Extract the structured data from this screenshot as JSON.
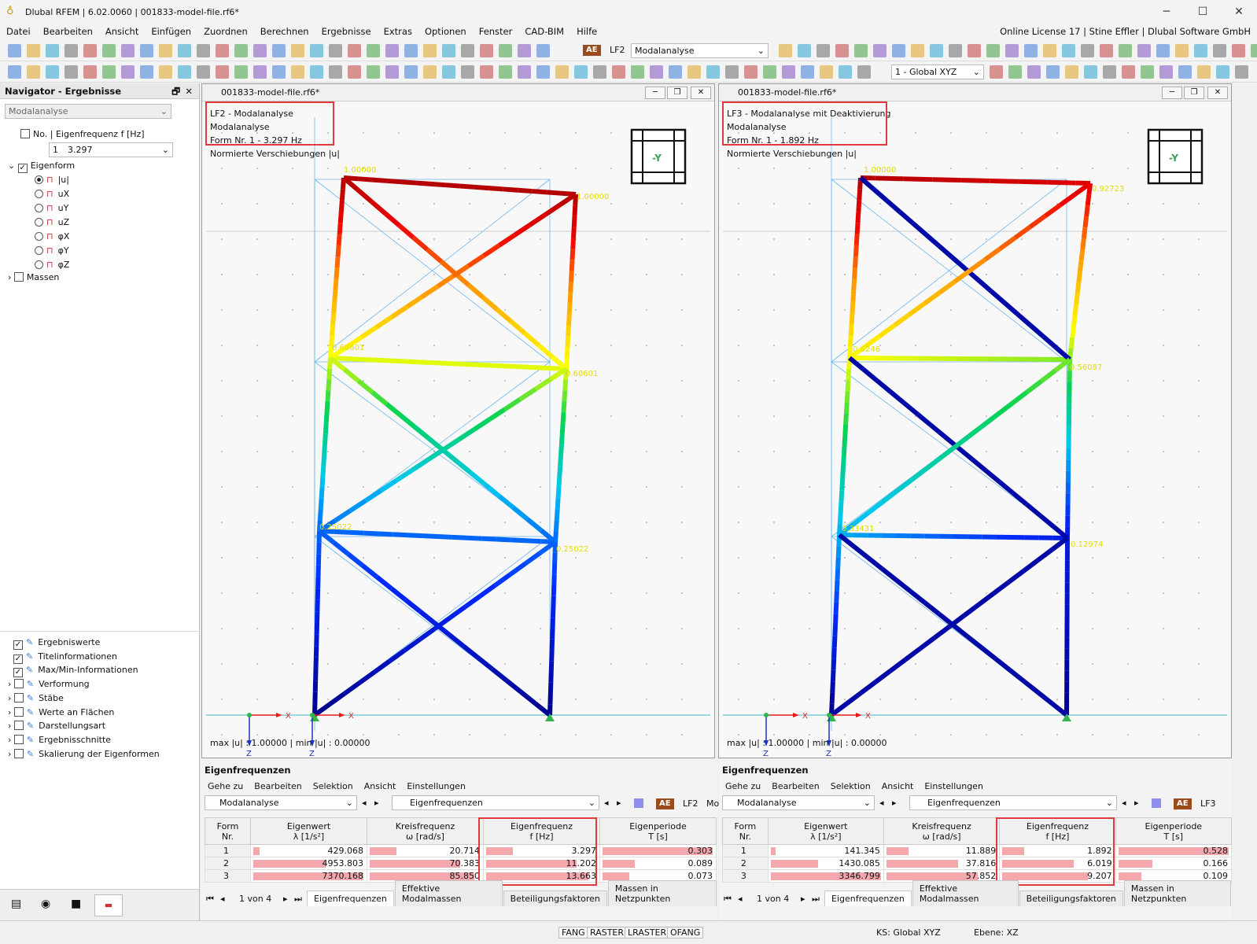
{
  "window": {
    "title": "Dlubal RFEM | 6.02.0060 | 001833-model-file.rf6*",
    "min": "─",
    "max": "☐",
    "close": "✕"
  },
  "menu": {
    "items": [
      "Datei",
      "Bearbeiten",
      "Ansicht",
      "Einfügen",
      "Zuordnen",
      "Berechnen",
      "Ergebnisse",
      "Extras",
      "Optionen",
      "Fenster",
      "CAD-BIM",
      "Hilfe"
    ],
    "license": "Online License 17 | Stine Effler | Dlubal Software GmbH"
  },
  "toolbar": {
    "ae_badge": "AE",
    "loadcase": "LF2",
    "analysis": "Modalanalyse",
    "coord_system": "1 - Global XYZ"
  },
  "navigator": {
    "title": "Navigator - Ergebnisse",
    "analysis": "Modalanalyse",
    "freq_label": "No. | Eigenfrequenz f [Hz]",
    "freq_no": "1",
    "freq_value": "3.297",
    "eigenform": "Eigenform",
    "components": [
      "|u|",
      "uX",
      "uY",
      "uZ",
      "φX",
      "φY",
      "φZ"
    ],
    "massen": "Massen",
    "bottom_items": [
      "Ergebniswerte",
      "Titelinformationen",
      "Max/Min-Informationen",
      "Verformung",
      "Stäbe",
      "Werte an Flächen",
      "Darstellungsart",
      "Ergebnisschnitte",
      "Skalierung der Eigenformen"
    ]
  },
  "views": [
    {
      "file": "001833-model-file.rf6*",
      "line1": "LF2 - Modalanalyse",
      "line2": "Modalanalyse",
      "line3": "Form Nr. 1 - 3.297 Hz",
      "line4": "Normierte Verschiebungen |u|",
      "maxmin": "max |u| : 1.00000 | min |u| : 0.00000",
      "cube": "-Y",
      "labels": [
        "1.00000",
        "1.00000",
        "0.60601",
        "0.60601",
        "0.25022",
        "0.25022"
      ]
    },
    {
      "file": "001833-model-file.rf6*",
      "line1": "LF3 - Modalanalyse mit Deaktivierung",
      "line2": "Modalanalyse",
      "line3": "Form Nr. 1 - 1.892 Hz",
      "line4": "Normierte Verschiebungen |u|",
      "maxmin": "max |u| : 1.00000 | min |u| : 0.00000",
      "cube": "-Y",
      "labels": [
        "1.00000",
        "0.92723",
        "0.6246",
        "0.56087",
        "0.33431",
        "0.12974"
      ]
    }
  ],
  "axes": {
    "x": "X",
    "z": "Z"
  },
  "panels": [
    {
      "title": "Eigenfrequenzen",
      "menu": [
        "Gehe zu",
        "Bearbeiten",
        "Selektion",
        "Ansicht",
        "Einstellungen"
      ],
      "combo1": "Modalanalyse",
      "combo2": "Eigenfrequenzen",
      "ae": "AE",
      "lf": "LF2",
      "mo": "Mo",
      "headers": [
        [
          "Form",
          "Nr."
        ],
        [
          "Eigenwert",
          "λ [1/s²]"
        ],
        [
          "Kreisfrequenz",
          "ω [rad/s]"
        ],
        [
          "Eigenfrequenz",
          "f [Hz]"
        ],
        [
          "Eigenperiode",
          "T [s]"
        ]
      ],
      "rows": [
        [
          "1",
          "429.068",
          "20.714",
          "3.297",
          "0.303"
        ],
        [
          "2",
          "4953.803",
          "70.383",
          "11.202",
          "0.089"
        ],
        [
          "3",
          "7370.168",
          "85.850",
          "13.663",
          "0.073"
        ]
      ],
      "bars": [
        [
          0.06,
          0.66,
          1.0
        ],
        [
          0.24,
          0.82,
          0.95
        ],
        [
          0.24,
          0.82,
          0.93
        ],
        [
          1.0,
          0.29,
          0.24
        ]
      ],
      "pager": "1 von 4",
      "tabs": [
        "Eigenfrequenzen",
        "Effektive Modalmassen",
        "Beteiligungsfaktoren",
        "Massen in Netzpunkten"
      ]
    },
    {
      "title": "Eigenfrequenzen",
      "menu": [
        "Gehe zu",
        "Bearbeiten",
        "Selektion",
        "Ansicht",
        "Einstellungen"
      ],
      "combo1": "Modalanalyse",
      "combo2": "Eigenfrequenzen",
      "ae": "AE",
      "lf": "LF3",
      "mo": "",
      "headers": [
        [
          "Form",
          "Nr."
        ],
        [
          "Eigenwert",
          "λ [1/s²]"
        ],
        [
          "Kreisfrequenz",
          "ω [rad/s]"
        ],
        [
          "Eigenfrequenz",
          "f [Hz]"
        ],
        [
          "Eigenperiode",
          "T [s]"
        ]
      ],
      "rows": [
        [
          "1",
          "141.345",
          "11.889",
          "1.892",
          "0.528"
        ],
        [
          "2",
          "1430.085",
          "37.816",
          "6.019",
          "0.166"
        ],
        [
          "3",
          "3346.799",
          "57.852",
          "9.207",
          "0.109"
        ]
      ],
      "bars": [
        [
          0.04,
          0.43,
          1.0
        ],
        [
          0.2,
          0.65,
          0.83
        ],
        [
          0.2,
          0.65,
          0.78
        ],
        [
          1.0,
          0.31,
          0.21
        ]
      ],
      "pager": "1 von 4",
      "tabs": [
        "Eigenfrequenzen",
        "Effektive Modalmassen",
        "Beteiligungsfaktoren",
        "Massen in Netzpunkten"
      ]
    }
  ],
  "status": {
    "items": [
      "FANG",
      "RASTER",
      "LRASTER",
      "OFANG"
    ],
    "ks": "KS: Global XYZ",
    "ebene": "Ebene: XZ"
  }
}
